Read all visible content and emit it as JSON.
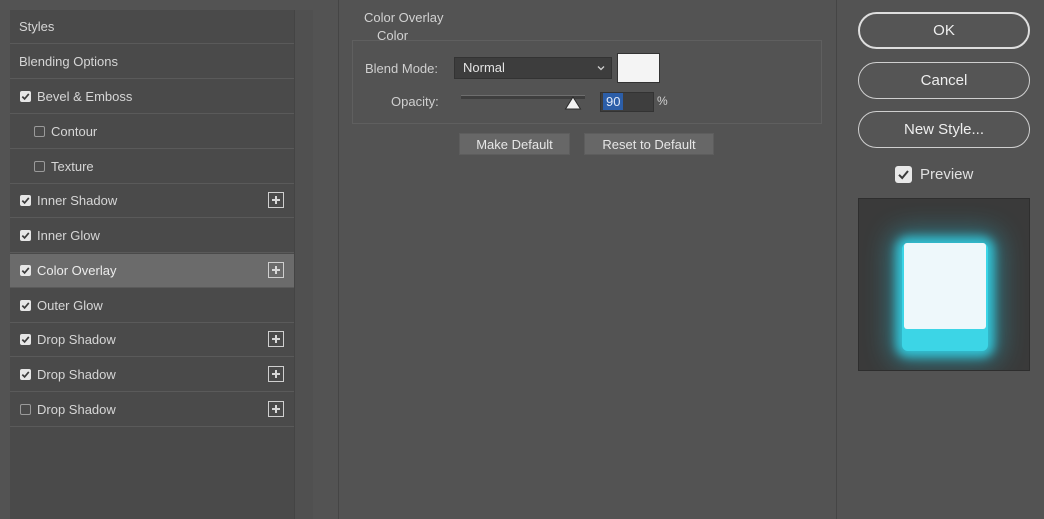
{
  "left_panel": {
    "styles_label": "Styles",
    "blending_label": "Blending Options",
    "items": [
      {
        "label": "Bevel & Emboss",
        "checked": true,
        "plus": false,
        "indent": false,
        "selected": false
      },
      {
        "label": "Contour",
        "checked": false,
        "plus": false,
        "indent": true,
        "selected": false
      },
      {
        "label": "Texture",
        "checked": false,
        "plus": false,
        "indent": true,
        "selected": false
      },
      {
        "label": "Inner Shadow",
        "checked": true,
        "plus": true,
        "indent": false,
        "selected": false
      },
      {
        "label": "Inner Glow",
        "checked": true,
        "plus": false,
        "indent": false,
        "selected": false
      },
      {
        "label": "Color Overlay",
        "checked": true,
        "plus": true,
        "indent": false,
        "selected": true
      },
      {
        "label": "Outer Glow",
        "checked": true,
        "plus": false,
        "indent": false,
        "selected": false
      },
      {
        "label": "Drop Shadow",
        "checked": true,
        "plus": true,
        "indent": false,
        "selected": false
      },
      {
        "label": "Drop Shadow",
        "checked": true,
        "plus": true,
        "indent": false,
        "selected": false
      },
      {
        "label": "Drop Shadow",
        "checked": false,
        "plus": true,
        "indent": false,
        "selected": false
      }
    ]
  },
  "overlay": {
    "section_title": "Color Overlay",
    "subsection_title": "Color",
    "blend_mode_label": "Blend Mode:",
    "blend_mode_value": "Normal",
    "overlay_color": "#f4f4f4",
    "opacity_label": "Opacity:",
    "opacity_value": "90",
    "opacity_unit": "%",
    "opacity_fraction": 0.9,
    "make_default_label": "Make Default",
    "reset_default_label": "Reset to Default"
  },
  "actions": {
    "ok_label": "OK",
    "cancel_label": "Cancel",
    "new_style_label": "New Style...",
    "preview_label": "Preview",
    "preview_checked": true
  },
  "colors": {
    "glow": "#3cd5e6",
    "selection": "#2c5ea8"
  }
}
